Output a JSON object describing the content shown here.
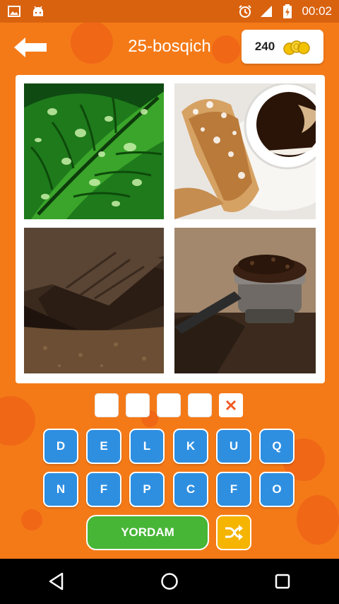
{
  "status_bar": {
    "time": "00:02",
    "icons": [
      "image-icon",
      "android-icon",
      "alarm-icon",
      "signal-icon",
      "battery-icon"
    ]
  },
  "header": {
    "back_icon": "arrow-left-icon",
    "level_title": "25-bosqich",
    "coins": "240",
    "coins_icon": "gold-coins-icon"
  },
  "pictures": [
    {
      "name": "coffee-leaf-picture"
    },
    {
      "name": "pastry-coffee-cup-picture"
    },
    {
      "name": "chocolate-bar-picture"
    },
    {
      "name": "espresso-portafilter-picture"
    }
  ],
  "answer": {
    "slots": [
      "",
      "",
      "",
      ""
    ],
    "clear_label": "✕"
  },
  "keyboard": {
    "row1": [
      "D",
      "E",
      "L",
      "K",
      "U",
      "Q"
    ],
    "row2": [
      "N",
      "F",
      "P",
      "C",
      "F",
      "O"
    ]
  },
  "buttons": {
    "help_label": "YORDAM",
    "shuffle_icon": "shuffle-icon"
  },
  "nav_bar": {
    "icons": [
      "back-triangle-icon",
      "home-circle-icon",
      "recents-square-icon"
    ]
  },
  "colors": {
    "background": "#f47a18",
    "key_blue": "#2e8fe1",
    "help_green": "#47b536",
    "shuffle_yellow": "#f5b400",
    "clear_red": "#f05a22"
  }
}
